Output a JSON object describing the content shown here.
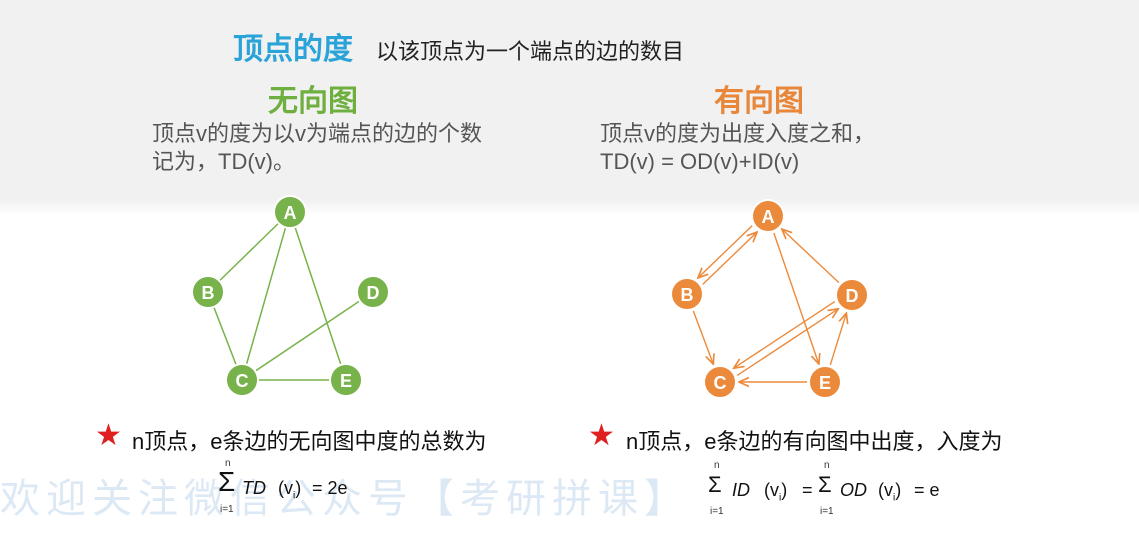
{
  "header": {
    "title": "顶点的度",
    "definition": "以该顶点为一个端点的边的数目"
  },
  "undirected": {
    "heading": "无向图",
    "desc_line1": "顶点v的度为以v为端点的边的个数",
    "desc_line2": "记为，TD(v)。",
    "statement": "n顶点，e条边的无向图中度的总数为",
    "formula": {
      "sum_top": "n",
      "sum_bottom": "i=1",
      "fn": "TD",
      "arg": "(v",
      "arg_sub": "i",
      "arg_close": ")",
      "rhs": "= 2e"
    },
    "nodes": [
      "A",
      "B",
      "C",
      "D",
      "E"
    ],
    "edges": [
      [
        "A",
        "B"
      ],
      [
        "A",
        "C"
      ],
      [
        "A",
        "E"
      ],
      [
        "B",
        "C"
      ],
      [
        "C",
        "D"
      ],
      [
        "C",
        "E"
      ]
    ],
    "color": "#78b24a"
  },
  "directed": {
    "heading": "有向图",
    "desc_line1": "顶点v的度为出度入度之和，",
    "desc_line2": "TD(v) = OD(v)+ID(v)",
    "statement": "n顶点，e条边的有向图中出度，入度为",
    "formula": {
      "sum1_top": "n",
      "sum1_bottom": "i=1",
      "fn1": "ID",
      "arg1": "(v",
      "arg1_sub": "i",
      "arg1_close": ")",
      "eq1": "=",
      "sum2_top": "n",
      "sum2_bottom": "i=1",
      "fn2": "OD",
      "arg2": "(v",
      "arg2_sub": "i",
      "arg2_close": ")",
      "rhs": "= e"
    },
    "nodes": [
      "A",
      "B",
      "C",
      "D",
      "E"
    ],
    "arcs": [
      [
        "A",
        "B"
      ],
      [
        "B",
        "A"
      ],
      [
        "B",
        "C"
      ],
      [
        "A",
        "E"
      ],
      [
        "D",
        "A"
      ],
      [
        "C",
        "D"
      ],
      [
        "D",
        "C"
      ],
      [
        "E",
        "C"
      ],
      [
        "E",
        "D"
      ]
    ],
    "color": "#ec8a3c"
  },
  "watermark": "欢迎关注微信公众号【考研拼课】",
  "colors": {
    "title_blue": "#2aa3d8",
    "green": "#6faf3f",
    "orange": "#e8873a",
    "star_red": "#e02020"
  }
}
